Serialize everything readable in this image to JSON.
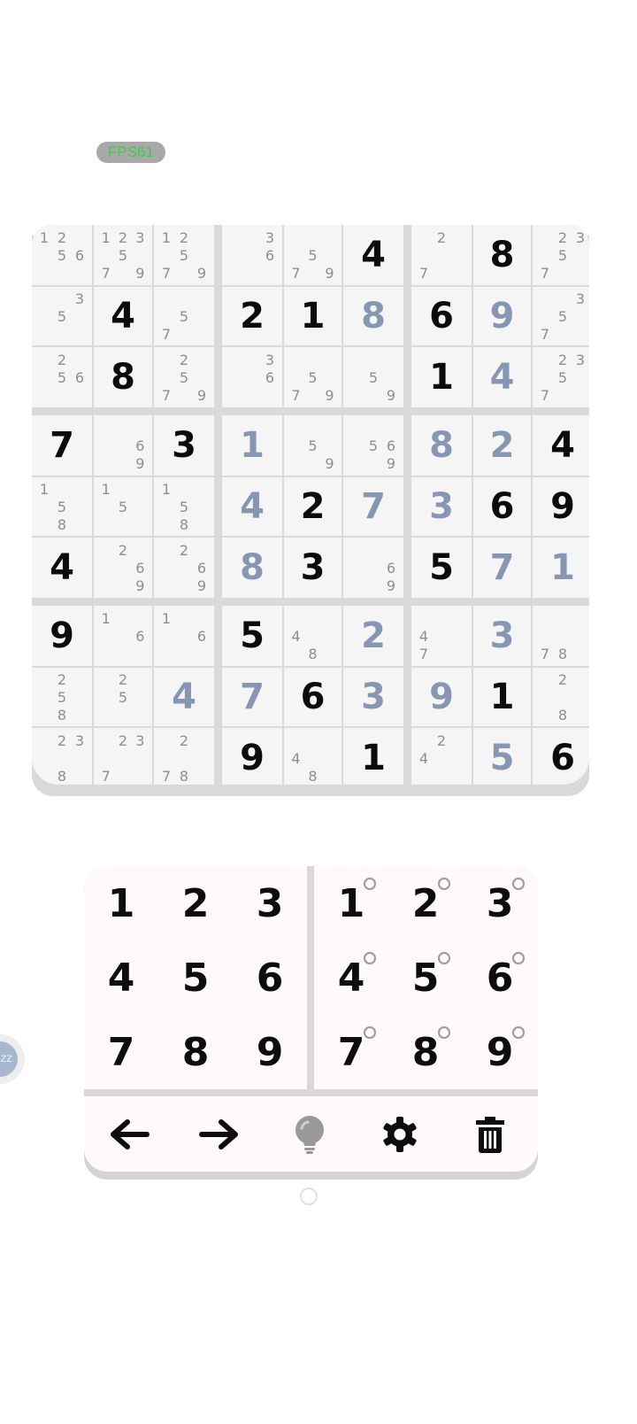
{
  "fps_label": "FPS61",
  "side_bubble_text": "zz",
  "colors": {
    "given": "#0b0b0b",
    "entered": "#8797b3",
    "notes": "#8e8e8e",
    "fps_text": "#3dcb48"
  },
  "grid": [
    [
      {
        "n": "1256"
      },
      {
        "n": "12357 9"
      },
      {
        "n": "1257 9"
      },
      {
        "n": "36"
      },
      {
        "n": "57 9"
      },
      {
        "g": "4"
      },
      {
        "n": "27"
      },
      {
        "g": "8"
      },
      {
        "n": "2357"
      }
    ],
    [
      {
        "n": "35"
      },
      {
        "g": "4"
      },
      {
        "n": "57"
      },
      {
        "g": "2"
      },
      {
        "g": "1"
      },
      {
        "e": "8"
      },
      {
        "g": "6"
      },
      {
        "e": "9"
      },
      {
        "n": "357"
      }
    ],
    [
      {
        "n": "256"
      },
      {
        "g": "8"
      },
      {
        "n": "2579"
      },
      {
        "n": "36"
      },
      {
        "n": "579"
      },
      {
        "n": "59"
      },
      {
        "g": "1"
      },
      {
        "e": "4"
      },
      {
        "n": "2357"
      }
    ],
    [
      {
        "g": "7"
      },
      {
        "n": "69"
      },
      {
        "g": "3"
      },
      {
        "e": "1"
      },
      {
        "n": "59"
      },
      {
        "n": "569"
      },
      {
        "e": "8"
      },
      {
        "e": "2"
      },
      {
        "g": "4"
      }
    ],
    [
      {
        "n": "158"
      },
      {
        "n": "15"
      },
      {
        "n": "158"
      },
      {
        "e": "4"
      },
      {
        "g": "2"
      },
      {
        "e": "7"
      },
      {
        "e": "3"
      },
      {
        "g": "6"
      },
      {
        "g": "9"
      }
    ],
    [
      {
        "g": "4"
      },
      {
        "n": "269"
      },
      {
        "n": "269"
      },
      {
        "e": "8"
      },
      {
        "g": "3"
      },
      {
        "n": "69"
      },
      {
        "g": "5"
      },
      {
        "e": "7"
      },
      {
        "e": "1"
      }
    ],
    [
      {
        "g": "9"
      },
      {
        "n": "16"
      },
      {
        "n": "16"
      },
      {
        "g": "5"
      },
      {
        "n": "48"
      },
      {
        "e": "2"
      },
      {
        "n": "47"
      },
      {
        "e": "3"
      },
      {
        "n": "78"
      }
    ],
    [
      {
        "n": "258"
      },
      {
        "n": "25"
      },
      {
        "e": "4"
      },
      {
        "e": "7"
      },
      {
        "g": "6"
      },
      {
        "e": "3"
      },
      {
        "e": "9"
      },
      {
        "g": "1"
      },
      {
        "n": "28"
      }
    ],
    [
      {
        "n": "238"
      },
      {
        "n": "237"
      },
      {
        "n": "278"
      },
      {
        "g": "9"
      },
      {
        "n": "48"
      },
      {
        "g": "1"
      },
      {
        "n": "24"
      },
      {
        "e": "5"
      },
      {
        "g": "6"
      }
    ]
  ],
  "keypad": {
    "numbers": [
      "1",
      "2",
      "3",
      "4",
      "5",
      "6",
      "7",
      "8",
      "9"
    ],
    "notes": [
      "1",
      "2",
      "3",
      "4",
      "5",
      "6",
      "7",
      "8",
      "9"
    ]
  },
  "toolbar": [
    {
      "name": "undo",
      "icon": "arrow-left-icon"
    },
    {
      "name": "redo",
      "icon": "arrow-right-icon"
    },
    {
      "name": "hint",
      "icon": "lightbulb-icon"
    },
    {
      "name": "settings",
      "icon": "gear-icon"
    },
    {
      "name": "delete",
      "icon": "trash-icon"
    }
  ]
}
